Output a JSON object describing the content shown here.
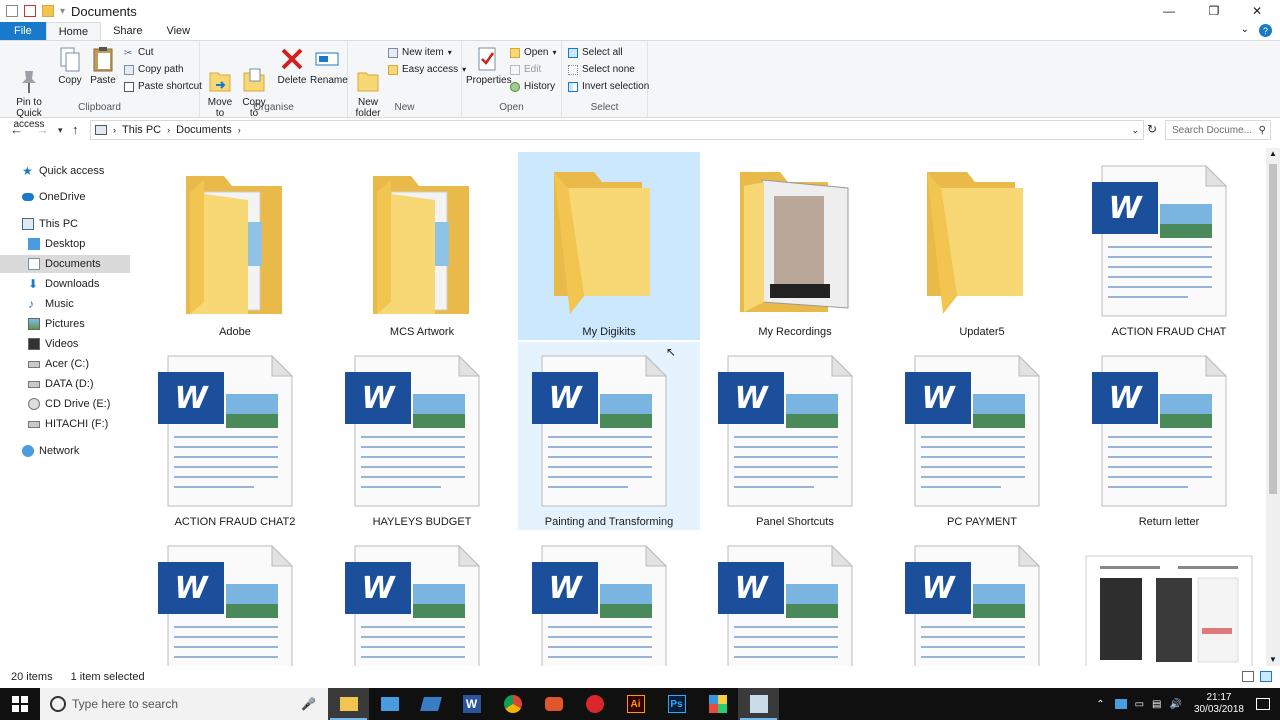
{
  "window": {
    "title": "Documents"
  },
  "tabs": [
    {
      "label": "File"
    },
    {
      "label": "Home"
    },
    {
      "label": "Share"
    },
    {
      "label": "View"
    }
  ],
  "ribbon": {
    "clipboard": {
      "label": "Clipboard",
      "pin": "Pin to Quick\naccess",
      "copy": "Copy",
      "paste": "Paste",
      "cut": "Cut",
      "copy_path": "Copy path",
      "paste_shortcut": "Paste shortcut"
    },
    "organise": {
      "label": "Organise",
      "move_to": "Move\nto",
      "copy_to": "Copy\nto",
      "delete": "Delete",
      "rename": "Rename"
    },
    "new": {
      "label": "New",
      "new_folder": "New\nfolder",
      "new_item": "New item",
      "easy_access": "Easy access"
    },
    "open": {
      "label": "Open",
      "properties": "Properties",
      "open": "Open",
      "edit": "Edit",
      "history": "History"
    },
    "select": {
      "label": "Select",
      "select_all": "Select all",
      "select_none": "Select none",
      "invert": "Invert selection"
    }
  },
  "address": {
    "crumbs": [
      "This PC",
      "Documents"
    ],
    "search_placeholder": "Search Docume..."
  },
  "nav": [
    {
      "label": "Quick access",
      "icon": "star-icon"
    },
    {
      "label": "OneDrive",
      "icon": "cloud-icon"
    },
    {
      "label": "This PC",
      "icon": "computer-icon"
    },
    {
      "label": "Desktop",
      "icon": "desktop-icon"
    },
    {
      "label": "Documents",
      "icon": "documents-icon",
      "selected": true
    },
    {
      "label": "Downloads",
      "icon": "downloads-icon"
    },
    {
      "label": "Music",
      "icon": "music-icon"
    },
    {
      "label": "Pictures",
      "icon": "pictures-icon"
    },
    {
      "label": "Videos",
      "icon": "videos-icon"
    },
    {
      "label": "Acer (C:)",
      "icon": "drive-icon"
    },
    {
      "label": "DATA (D:)",
      "icon": "drive-icon"
    },
    {
      "label": "CD Drive (E:)",
      "icon": "cd-icon"
    },
    {
      "label": "HITACHI (F:)",
      "icon": "drive-icon"
    },
    {
      "label": "Network",
      "icon": "network-icon"
    }
  ],
  "items": [
    {
      "label": "Adobe",
      "kind": "folder-docs"
    },
    {
      "label": "MCS Artwork",
      "kind": "folder-docs"
    },
    {
      "label": "My Digikits",
      "kind": "folder-empty",
      "state": "selected"
    },
    {
      "label": "My Recordings",
      "kind": "folder-photos"
    },
    {
      "label": "Updater5",
      "kind": "folder-empty"
    },
    {
      "label": "ACTION FRAUD CHAT",
      "kind": "word"
    },
    {
      "label": "ACTION FRAUD CHAT2",
      "kind": "word"
    },
    {
      "label": "HAYLEYS BUDGET",
      "kind": "word"
    },
    {
      "label": "Painting and Transforming",
      "kind": "word",
      "state": "hover"
    },
    {
      "label": "Panel Shortcuts",
      "kind": "word"
    },
    {
      "label": "PC PAYMENT",
      "kind": "word"
    },
    {
      "label": "Return letter",
      "kind": "word"
    },
    {
      "label": "",
      "kind": "word"
    },
    {
      "label": "",
      "kind": "word"
    },
    {
      "label": "",
      "kind": "word"
    },
    {
      "label": "",
      "kind": "word"
    },
    {
      "label": "",
      "kind": "word"
    },
    {
      "label": "",
      "kind": "doc-thumb"
    }
  ],
  "status": {
    "count": "20 items",
    "selected": "1 item selected"
  },
  "taskbar": {
    "search_placeholder": "Type here to search",
    "time": "21:17",
    "date": "30/03/2018"
  },
  "colors": {
    "accent": "#1979ca",
    "selection": "#cce8ff",
    "hover": "#e5f3ff",
    "folder": "#f8d775"
  }
}
